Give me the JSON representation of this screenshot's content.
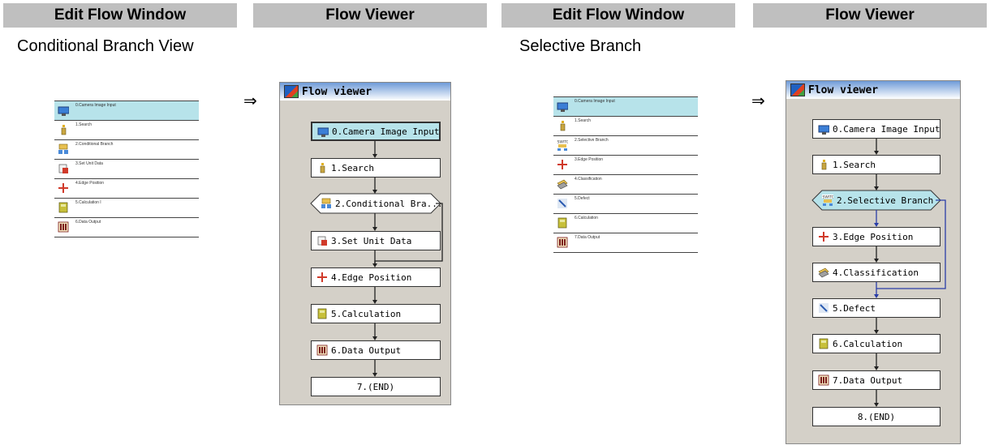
{
  "headers": [
    "Edit Flow Window",
    "Flow Viewer",
    "Edit Flow Window",
    "Flow Viewer"
  ],
  "left": {
    "subtitle": "Conditional Branch View",
    "edit_flow": [
      {
        "label": "0.Camera Image Input",
        "icon": "camera-icon",
        "selected": true
      },
      {
        "label": "1.Search",
        "icon": "search-icon"
      },
      {
        "label": "2.Conditional Branch",
        "icon": "branch-icon"
      },
      {
        "label": "3.Set Unit Data",
        "icon": "set-data-icon"
      },
      {
        "label": "4.Edge Position",
        "icon": "edge-icon"
      },
      {
        "label": "5.Calculation I",
        "icon": "calculator-icon"
      },
      {
        "label": "6.Data Output",
        "icon": "data-output-icon"
      }
    ],
    "arrow": "⇒",
    "viewer": {
      "title": "Flow viewer",
      "nodes": [
        {
          "label": "0.Camera Image Input",
          "icon": "camera-icon"
        },
        {
          "label": "1.Search",
          "icon": "search-icon"
        },
        {
          "label": "2.Conditional Bra...",
          "icon": "branch-icon"
        },
        {
          "label": "3.Set Unit Data",
          "icon": "set-data-icon"
        },
        {
          "label": "4.Edge Position",
          "icon": "edge-icon"
        },
        {
          "label": "5.Calculation",
          "icon": "calculator-icon"
        },
        {
          "label": "6.Data Output",
          "icon": "data-output-icon"
        },
        {
          "label": "7.(END)"
        }
      ]
    }
  },
  "right": {
    "subtitle": "Selective Branch",
    "edit_flow": [
      {
        "label": "0.Camera Image Input",
        "icon": "camera-icon",
        "selected": true
      },
      {
        "label": "1.Search",
        "icon": "search-icon"
      },
      {
        "label": "2.Selective Branch",
        "icon": "switch-icon"
      },
      {
        "label": "3.Edge Position",
        "icon": "edge-icon"
      },
      {
        "label": "4.Classification",
        "icon": "classification-icon"
      },
      {
        "label": "5.Defect",
        "icon": "defect-icon"
      },
      {
        "label": "6.Calculation",
        "icon": "calculator-icon"
      },
      {
        "label": "7.Data Output",
        "icon": "data-output-icon"
      }
    ],
    "arrow": "⇒",
    "viewer": {
      "title": "Flow viewer",
      "nodes": [
        {
          "label": "0.Camera Image Input",
          "icon": "camera-icon"
        },
        {
          "label": "1.Search",
          "icon": "search-icon"
        },
        {
          "label": "2.Selective Branch",
          "icon": "switch-icon"
        },
        {
          "label": "3.Edge Position",
          "icon": "edge-icon"
        },
        {
          "label": "4.Classification",
          "icon": "classification-icon"
        },
        {
          "label": "5.Defect",
          "icon": "defect-icon"
        },
        {
          "label": "6.Calculation",
          "icon": "calculator-icon"
        },
        {
          "label": "7.Data Output",
          "icon": "data-output-icon"
        },
        {
          "label": "8.(END)"
        }
      ]
    }
  },
  "colors": {
    "header_bg": "#bfbfbf",
    "selected_bg": "#b7e3ea",
    "branch_line": "#2a3ea8",
    "viewer_bg": "#d4d0c8"
  }
}
